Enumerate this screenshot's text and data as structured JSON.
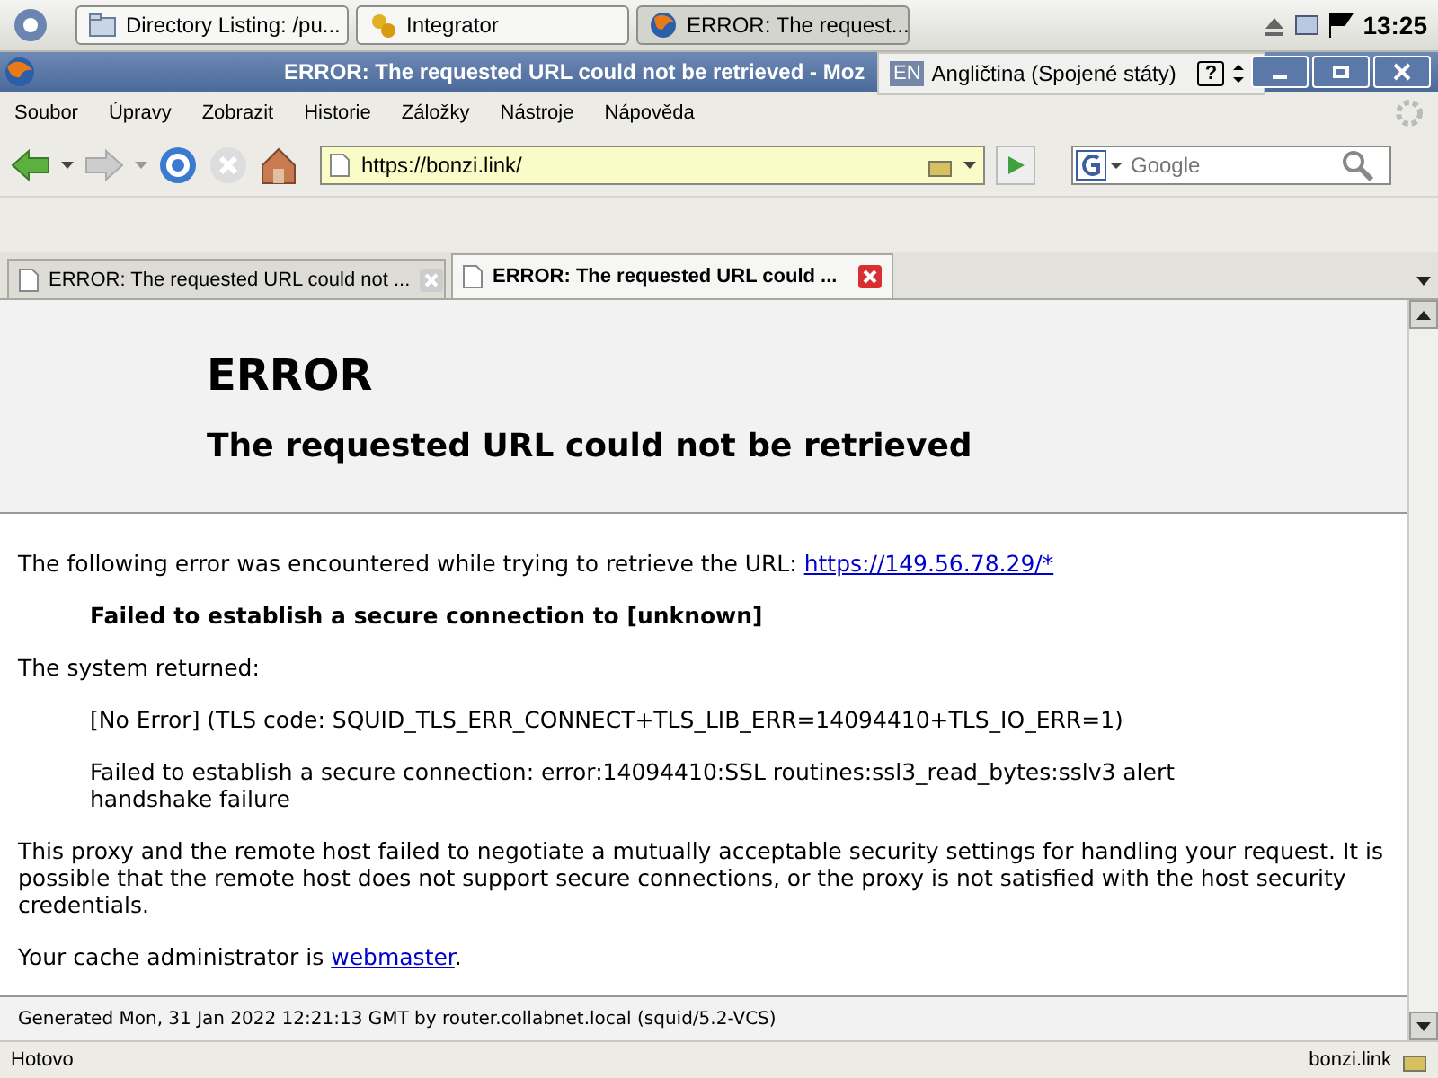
{
  "taskbar": {
    "tasks": [
      {
        "label": "Directory Listing: /pu...",
        "selected": false
      },
      {
        "label": "Integrator",
        "selected": false
      },
      {
        "label": "ERROR: The request...",
        "selected": true
      }
    ],
    "clock": "13:25"
  },
  "window": {
    "title": "ERROR: The requested URL could not be retrieved - Moz"
  },
  "language_bar": {
    "code": "EN",
    "language": "Angličtina (Spojené státy)",
    "help": "?"
  },
  "menu": [
    "Soubor",
    "Úpravy",
    "Zobrazit",
    "Historie",
    "Záložky",
    "Nástroje",
    "Nápověda"
  ],
  "address": {
    "value": "https://bonzi.link/"
  },
  "search": {
    "placeholder": "Google"
  },
  "tabs": [
    {
      "label": "ERROR: The requested URL could not ...",
      "selected": false
    },
    {
      "label": "ERROR: The requested URL could ...",
      "selected": true
    }
  ],
  "page": {
    "heading": "ERROR",
    "subheading": "The requested URL could not be retrieved",
    "intro": "The following error was encountered while trying to retrieve the URL: ",
    "intro_link": "https://149.56.78.29/*",
    "failure": "Failed to establish a secure connection to [unknown]",
    "system_returned": "The system returned:",
    "returned": [
      "[No Error] (TLS code: SQUID_TLS_ERR_CONNECT+TLS_LIB_ERR=14094410+TLS_IO_ERR=1)",
      "Failed to establish a secure connection: error:14094410:SSL routines:ssl3_read_bytes:sslv3 alert handshake failure"
    ],
    "explanation": "This proxy and the remote host failed to negotiate a mutually acceptable security settings for handling your request. It is possible that the remote host does not support secure connections, or the proxy is not satisfied with the host security credentials.",
    "admin": "Your cache administrator is ",
    "admin_link": "webmaster",
    "admin_end": ".",
    "footer": "Generated Mon, 31 Jan 2022 12:21:13 GMT by router.collabnet.local (squid/5.2-VCS)"
  },
  "status_bar": {
    "text": "Hotovo",
    "host": "bonzi.link"
  }
}
